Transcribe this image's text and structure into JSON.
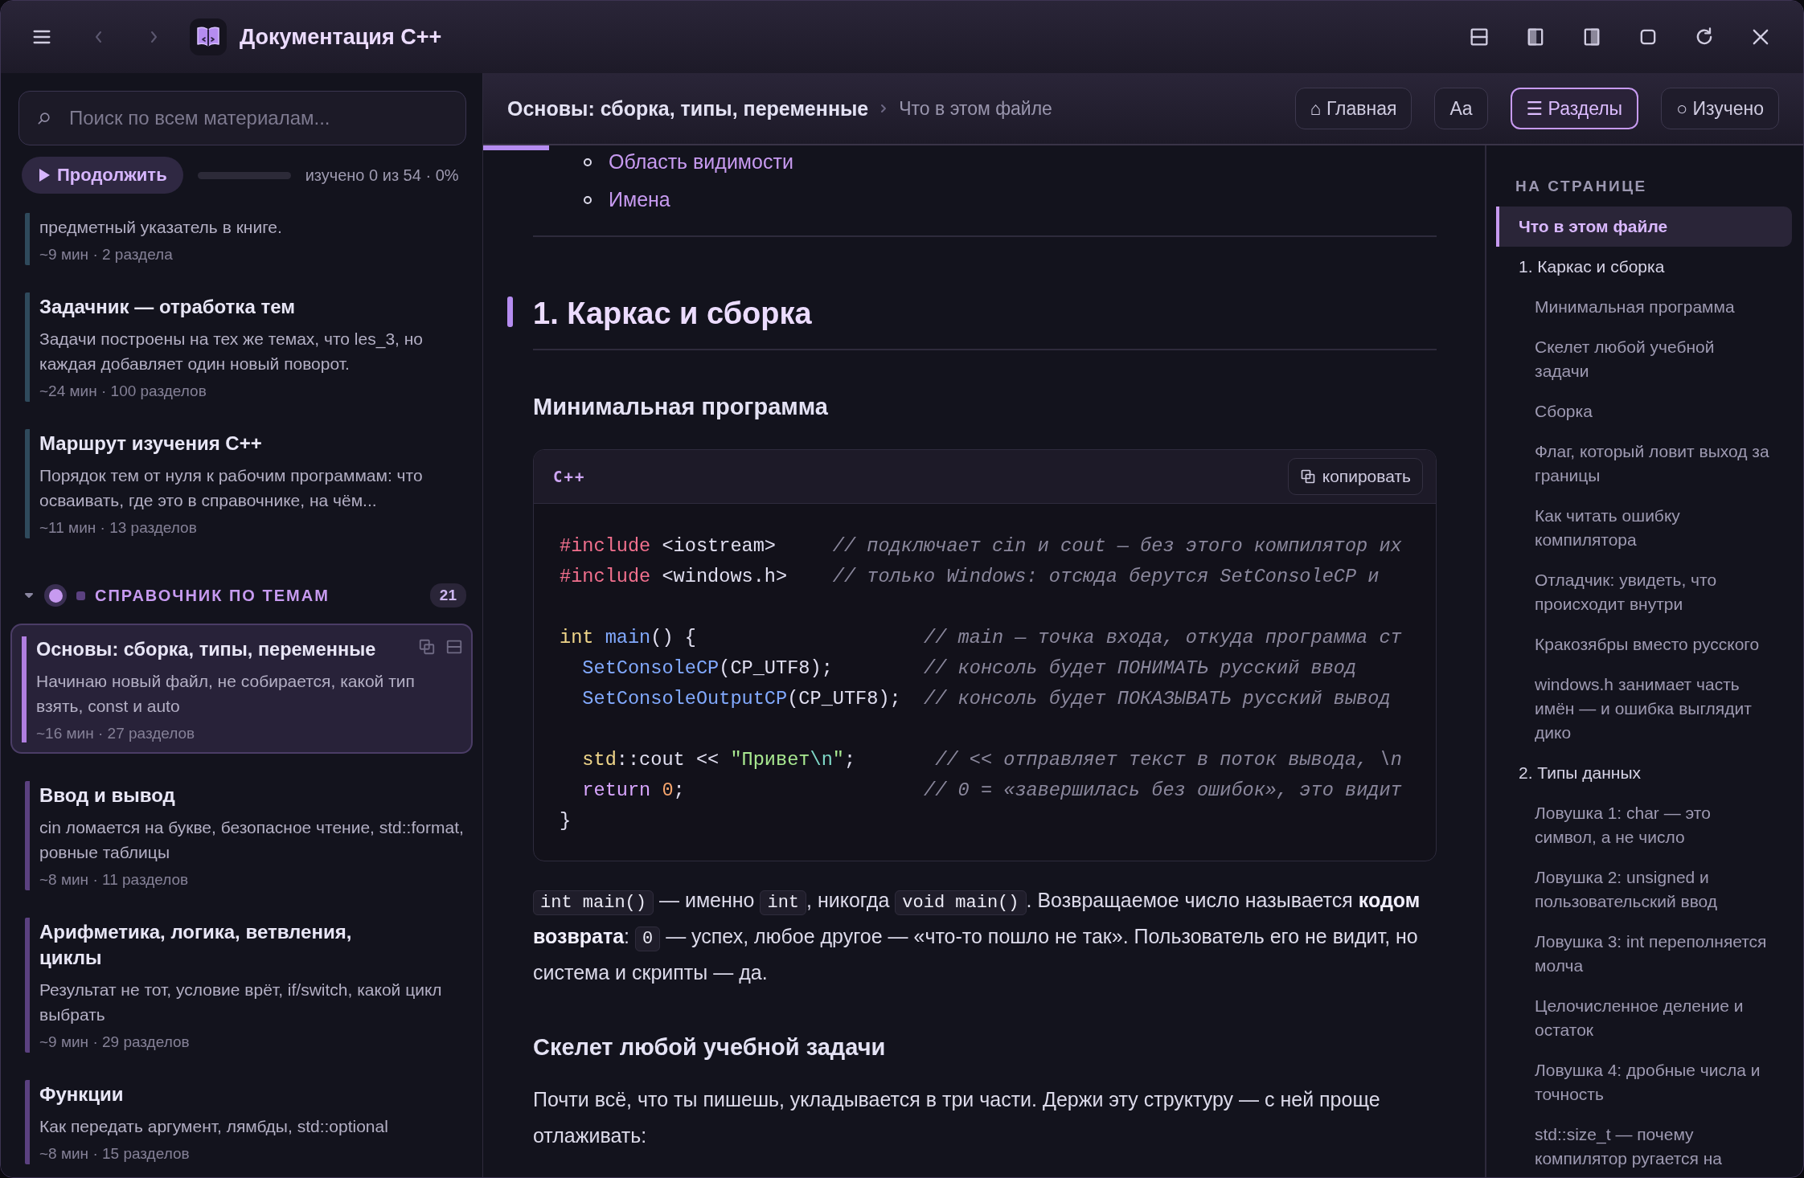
{
  "window": {
    "title": "Документация C++"
  },
  "sidebar": {
    "search": {
      "placeholder": "Поиск по всем материалам..."
    },
    "continue_button": "Продолжить",
    "progress": {
      "level": 0
    },
    "progress_text": "изучено 0 из 54 · 0%",
    "groups": [
      {
        "color": "#2f4a5c",
        "items": [
          {
            "description": "предметный указатель в книге.",
            "meta": "~9 мин · 2 раздела",
            "selected": false
          },
          {
            "title": "Задачник — отработка тем",
            "description": "Задачи построены на тех же темах, что les_3, но каждая добавляет один новый поворот.",
            "meta": "~24 мин · 100 разделов",
            "selected": false
          },
          {
            "title": "Маршрут изучения C++",
            "description": "Порядок тем от нуля к рабочим программам: что осваивать, где это в справочнике, на чём...",
            "meta": "~11 мин · 13 разделов",
            "selected": false
          }
        ]
      },
      {
        "color": "#5b4180",
        "header": {
          "title": "СПРАВОЧНИК ПО ТЕМАМ",
          "count": "21",
          "expanded": true
        },
        "items": [
          {
            "title": "Основы: сборка, типы, переменные",
            "description": "Начинаю новый файл, не собирается, какой тип взять, const и auto",
            "meta": "~16 мин · 27 разделов",
            "selected": true
          },
          {
            "title": "Ввод и вывод",
            "description": "cin ломается на букве, безопасное чтение, std::format, ровные таблицы",
            "meta": "~8 мин · 11 разделов",
            "selected": false
          },
          {
            "title": "Арифметика, логика, ветвления, циклы",
            "description": "Результат не тот, условие врёт, if/switch, какой цикл выбрать",
            "meta": "~9 мин · 29 разделов",
            "selected": false
          },
          {
            "title": "Функции",
            "description": "Как передать аргумент, лямбды, std::optional",
            "meta": "~8 мин · 15 разделов",
            "selected": false
          }
        ]
      }
    ]
  },
  "doc_header": {
    "breadcrumb": [
      "Основы: сборка, типы, переменные",
      "Что в этом файле"
    ],
    "buttons": [
      {
        "label": "⌂ Главная",
        "selected": false
      },
      {
        "label": "Aa",
        "selected": false
      },
      {
        "label": "☰ Разделы",
        "selected": true
      },
      {
        "label": "○ Изучено",
        "selected": false
      }
    ]
  },
  "reading_progress": {
    "level": 0.066
  },
  "content": {
    "blocks": [
      {
        "kind": "list",
        "items": [
          "Область видимости",
          "Имена"
        ]
      },
      {
        "kind": "rule"
      },
      {
        "kind": "h2",
        "text": "1. Каркас и сборка"
      },
      {
        "kind": "rule"
      },
      {
        "kind": "h3",
        "text": "Минимальная программа"
      },
      {
        "kind": "code",
        "language": "C++",
        "copy_label": "копировать",
        "lines": [
          {
            "kind": "code",
            "parts": [
              {
                "kind": "pp",
                "text": "#include"
              },
              {
                "kind": "plain",
                "text": " <iostream>     "
              },
              {
                "kind": "comment",
                "text": "// подключает cin и cout — без этого компилятор их"
              }
            ]
          },
          {
            "kind": "code",
            "parts": [
              {
                "kind": "pp",
                "text": "#include"
              },
              {
                "kind": "plain",
                "text": " <windows.h>    "
              },
              {
                "kind": "comment",
                "text": "// только Windows: отсюда берутся SetConsoleCP и"
              }
            ]
          },
          {
            "kind": "blank"
          },
          {
            "kind": "code",
            "parts": [
              {
                "kind": "type",
                "text": "int"
              },
              {
                "kind": "fn",
                "text": " main"
              },
              {
                "kind": "plain",
                "text": "() {                    "
              },
              {
                "kind": "comment",
                "text": "// main — точка входа, откуда программа ст"
              }
            ]
          },
          {
            "kind": "code",
            "parts": [
              {
                "kind": "fn",
                "text": "  SetConsoleCP"
              },
              {
                "kind": "plain",
                "text": "(CP_UTF8);        "
              },
              {
                "kind": "comment",
                "text": "// консоль будет ПОНИМАТЬ русский ввод"
              }
            ]
          },
          {
            "kind": "code",
            "parts": [
              {
                "kind": "fn",
                "text": "  SetConsoleOutputCP"
              },
              {
                "kind": "plain",
                "text": "(CP_UTF8);  "
              },
              {
                "kind": "comment",
                "text": "// консоль будет ПОКАЗЫВАТЬ русский вывод"
              }
            ]
          },
          {
            "kind": "blank"
          },
          {
            "kind": "code",
            "parts": [
              {
                "kind": "type",
                "text": "  std"
              },
              {
                "kind": "plain",
                "text": "::cout << "
              },
              {
                "kind": "str",
                "text": "\"Привет"
              },
              {
                "kind": "escape",
                "text": "\\n"
              },
              {
                "kind": "str",
                "text": "\""
              },
              {
                "kind": "plain",
                "text": ";       "
              },
              {
                "kind": "comment",
                "text": "// << отправляет текст в поток вывода, \\n"
              }
            ]
          },
          {
            "kind": "code",
            "parts": [
              {
                "kind": "kw",
                "text": "  return"
              },
              {
                "kind": "num",
                "text": " 0"
              },
              {
                "kind": "plain",
                "text": ";                     "
              },
              {
                "kind": "comment",
                "text": "// 0 = «завершилась без ошибок», это видит"
              }
            ]
          },
          {
            "kind": "code",
            "parts": [
              {
                "kind": "plain",
                "text": "}"
              }
            ]
          }
        ]
      },
      {
        "kind": "paragraph",
        "parts": [
          {
            "kind": "code",
            "text": "int main()"
          },
          {
            "kind": "text",
            "text": " — именно "
          },
          {
            "kind": "code",
            "text": "int"
          },
          {
            "kind": "text",
            "text": ", никогда "
          },
          {
            "kind": "code",
            "text": "void main()"
          },
          {
            "kind": "text",
            "text": ". Возвращаемое число называется **кодом возврата**: "
          },
          {
            "kind": "code",
            "text": "0"
          },
          {
            "kind": "text",
            "text": " — успех, любое другое — «что-то пошло не так». Пользователь его не видит, но система и скрипты — да."
          }
        ]
      },
      {
        "kind": "h3",
        "text": "Скелет любой учебной задачи"
      },
      {
        "kind": "paragraph",
        "parts": [
          {
            "kind": "text",
            "text": "Почти всё, что ты пишешь, укладывается в три части. Держи эту структуру — с ней проще отлаживать:"
          }
        ]
      }
    ]
  },
  "toc": {
    "title": "НА СТРАНИЦЕ",
    "items": [
      {
        "label": "Что в этом файле",
        "selected": true
      },
      {
        "label": "1. Каркас и сборка",
        "selected": false,
        "children": [
          {
            "label": "Минимальная программа",
            "selected": false
          },
          {
            "label": "Скелет любой учебной задачи",
            "selected": false
          },
          {
            "label": "Сборка",
            "selected": false
          },
          {
            "label": "Флаг, который ловит выход за границы",
            "selected": false
          },
          {
            "label": "Как читать ошибку компилятора",
            "selected": false
          },
          {
            "label": "Отладчик: увидеть, что происходит внутри",
            "selected": false
          },
          {
            "label": "Кракозябры вместо русского",
            "selected": false
          },
          {
            "label": "windows.h занимает часть имён — и ошибка выглядит дико",
            "selected": false
          }
        ]
      },
      {
        "label": "2. Типы данных",
        "selected": false,
        "children": [
          {
            "label": "Ловушка 1: char — это символ, а не число",
            "selected": false
          },
          {
            "label": "Ловушка 2: unsigned и пользовательский ввод",
            "selected": false
          },
          {
            "label": "Ловушка 3: int переполняется молча",
            "selected": false
          },
          {
            "label": "Целочисленное деление и остаток",
            "selected": false
          },
          {
            "label": "Ловушка 4: дробные числа и точность",
            "selected": false
          },
          {
            "label": "std::size_t — почему компилятор ругается на",
            "selected": false
          }
        ]
      }
    ]
  }
}
